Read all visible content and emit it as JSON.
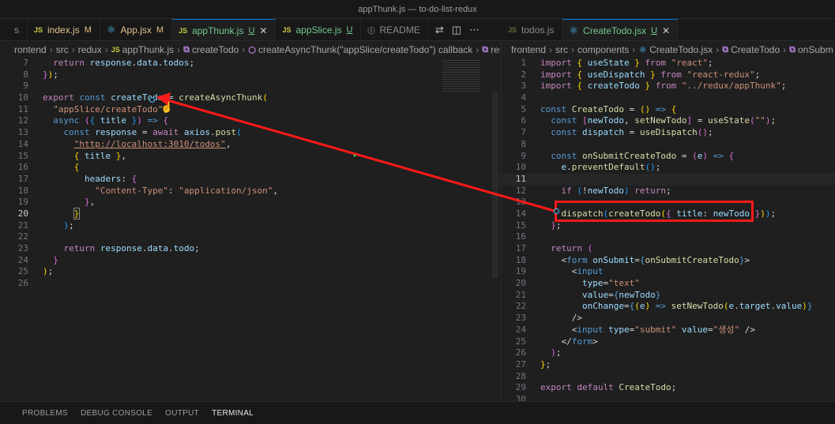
{
  "window": {
    "title": "appThunk.js — to-do-list-redux"
  },
  "left": {
    "tabs": [
      {
        "label": "s",
        "icon": "",
        "status": ""
      },
      {
        "label": "index.js",
        "icon": "JS",
        "status": "M"
      },
      {
        "label": "App.jsx",
        "icon": "react",
        "status": "M"
      },
      {
        "label": "appThunk.js",
        "icon": "JS",
        "status": "U",
        "active": true
      },
      {
        "label": "appSlice.js",
        "icon": "JS",
        "status": "U"
      },
      {
        "label": "README",
        "icon": "info",
        "status": ""
      }
    ],
    "breadcrumb": [
      "rontend",
      "src",
      "redux",
      "appThunk.js",
      "createTodo",
      "createAsyncThunk(\"appSlice/createTodo\") callback",
      "resp"
    ],
    "lines": [
      {
        "n": "7"
      },
      {
        "n": "8"
      },
      {
        "n": "9"
      },
      {
        "n": "10"
      },
      {
        "n": "11"
      },
      {
        "n": "12"
      },
      {
        "n": "13"
      },
      {
        "n": "14"
      },
      {
        "n": "15"
      },
      {
        "n": "16"
      },
      {
        "n": "17"
      },
      {
        "n": "18"
      },
      {
        "n": "19"
      },
      {
        "n": "20"
      },
      {
        "n": "21"
      },
      {
        "n": "22"
      },
      {
        "n": "23"
      },
      {
        "n": "24"
      },
      {
        "n": "25"
      },
      {
        "n": "26"
      }
    ]
  },
  "right": {
    "tabs": [
      {
        "label": "todos.js",
        "icon": "JS",
        "status": ""
      },
      {
        "label": "CreateTodo.jsx",
        "icon": "react",
        "status": "U",
        "active": true
      }
    ],
    "breadcrumb": [
      "frontend",
      "src",
      "components",
      "CreateTodo.jsx",
      "CreateTodo",
      "onSubm"
    ],
    "lines": [
      {
        "n": "1"
      },
      {
        "n": "2"
      },
      {
        "n": "3"
      },
      {
        "n": "4"
      },
      {
        "n": "5"
      },
      {
        "n": "6"
      },
      {
        "n": "7"
      },
      {
        "n": "8"
      },
      {
        "n": "9"
      },
      {
        "n": "10"
      },
      {
        "n": "11"
      },
      {
        "n": "12"
      },
      {
        "n": "13"
      },
      {
        "n": "14"
      },
      {
        "n": "15"
      },
      {
        "n": "16"
      },
      {
        "n": "17"
      },
      {
        "n": "18"
      },
      {
        "n": "19"
      },
      {
        "n": "20"
      },
      {
        "n": "21"
      },
      {
        "n": "22"
      },
      {
        "n": "23"
      },
      {
        "n": "24"
      },
      {
        "n": "25"
      },
      {
        "n": "26"
      },
      {
        "n": "27"
      },
      {
        "n": "28"
      },
      {
        "n": "29"
      },
      {
        "n": "30"
      }
    ]
  },
  "panel": {
    "tabs": [
      "PROBLEMS",
      "DEBUG CONSOLE",
      "OUTPUT",
      "TERMINAL"
    ],
    "active": "TERMINAL"
  },
  "code_left": {
    "l7": "return response.data.todos;",
    "l10_a": "export",
    "l10_b": "const",
    "l10_c": "createTodo",
    "l10_d": "createAsyncThunk(",
    "l11": "\"appSlice/createTodo\"",
    "l17_header": "\"Content-Type\"",
    "l17_val": "\"application/json\"",
    "url": "\"http://localhost:3010/todos\"",
    "l23": "return response.data.todo;"
  },
  "colors": {
    "accent": "#0078d4",
    "annotation": "#ff1a1a"
  }
}
